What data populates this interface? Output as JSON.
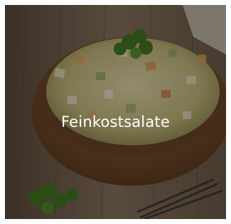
{
  "tile": {
    "title": "Feinkostsalate",
    "image_description_icon": "salad-bowl-photo"
  },
  "colors": {
    "overlay": "#140e0a",
    "caption_text": "#ffffff",
    "wood_table": "#7a6450",
    "bowl": "#8a5a34",
    "salad": "#d9cf9a",
    "parsley": "#4f8a2b"
  }
}
